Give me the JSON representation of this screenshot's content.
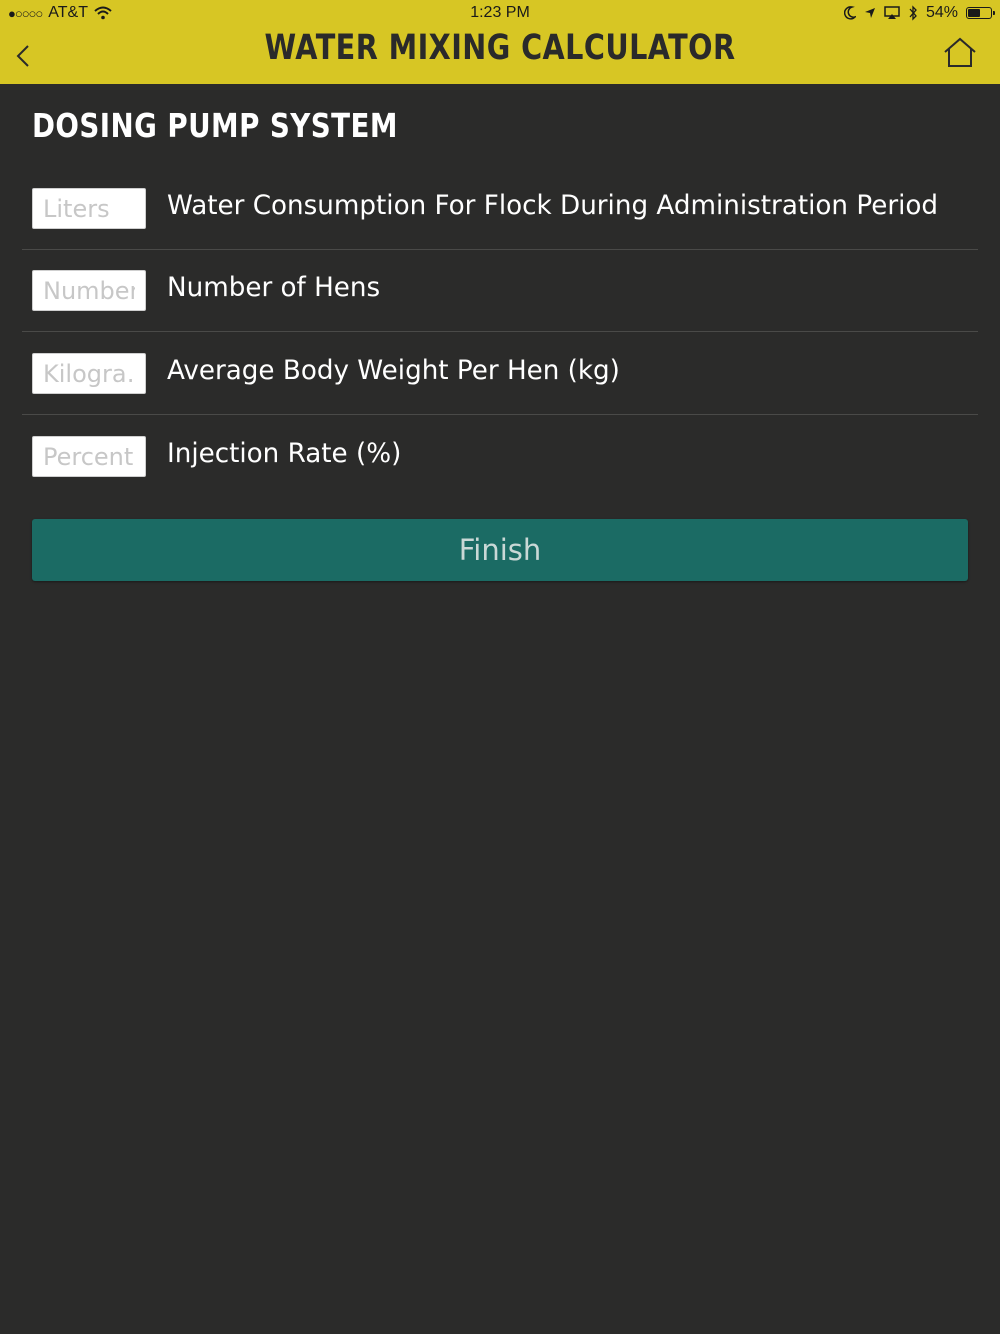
{
  "status_bar": {
    "carrier": "AT&T",
    "signal": "●○○○○",
    "time": "1:23 PM",
    "battery": "54%",
    "battery_level": 0.54
  },
  "header": {
    "title": "WATER MIXING CALCULATOR",
    "background": "#d7c624"
  },
  "section": {
    "title": "DOSING PUMP SYSTEM"
  },
  "fields": [
    {
      "placeholder": "Liters",
      "value": "",
      "label": "Water Consumption For Flock During Administration Period"
    },
    {
      "placeholder": "Number",
      "value": "",
      "label": "Number of Hens"
    },
    {
      "placeholder": "Kilogra…",
      "value": "",
      "label": "Average Body Weight Per Hen (kg)"
    },
    {
      "placeholder": "Percent",
      "value": "",
      "label": "Injection Rate (%)"
    }
  ],
  "finish_button": {
    "label": "Finish",
    "color": "#1b6b64"
  }
}
